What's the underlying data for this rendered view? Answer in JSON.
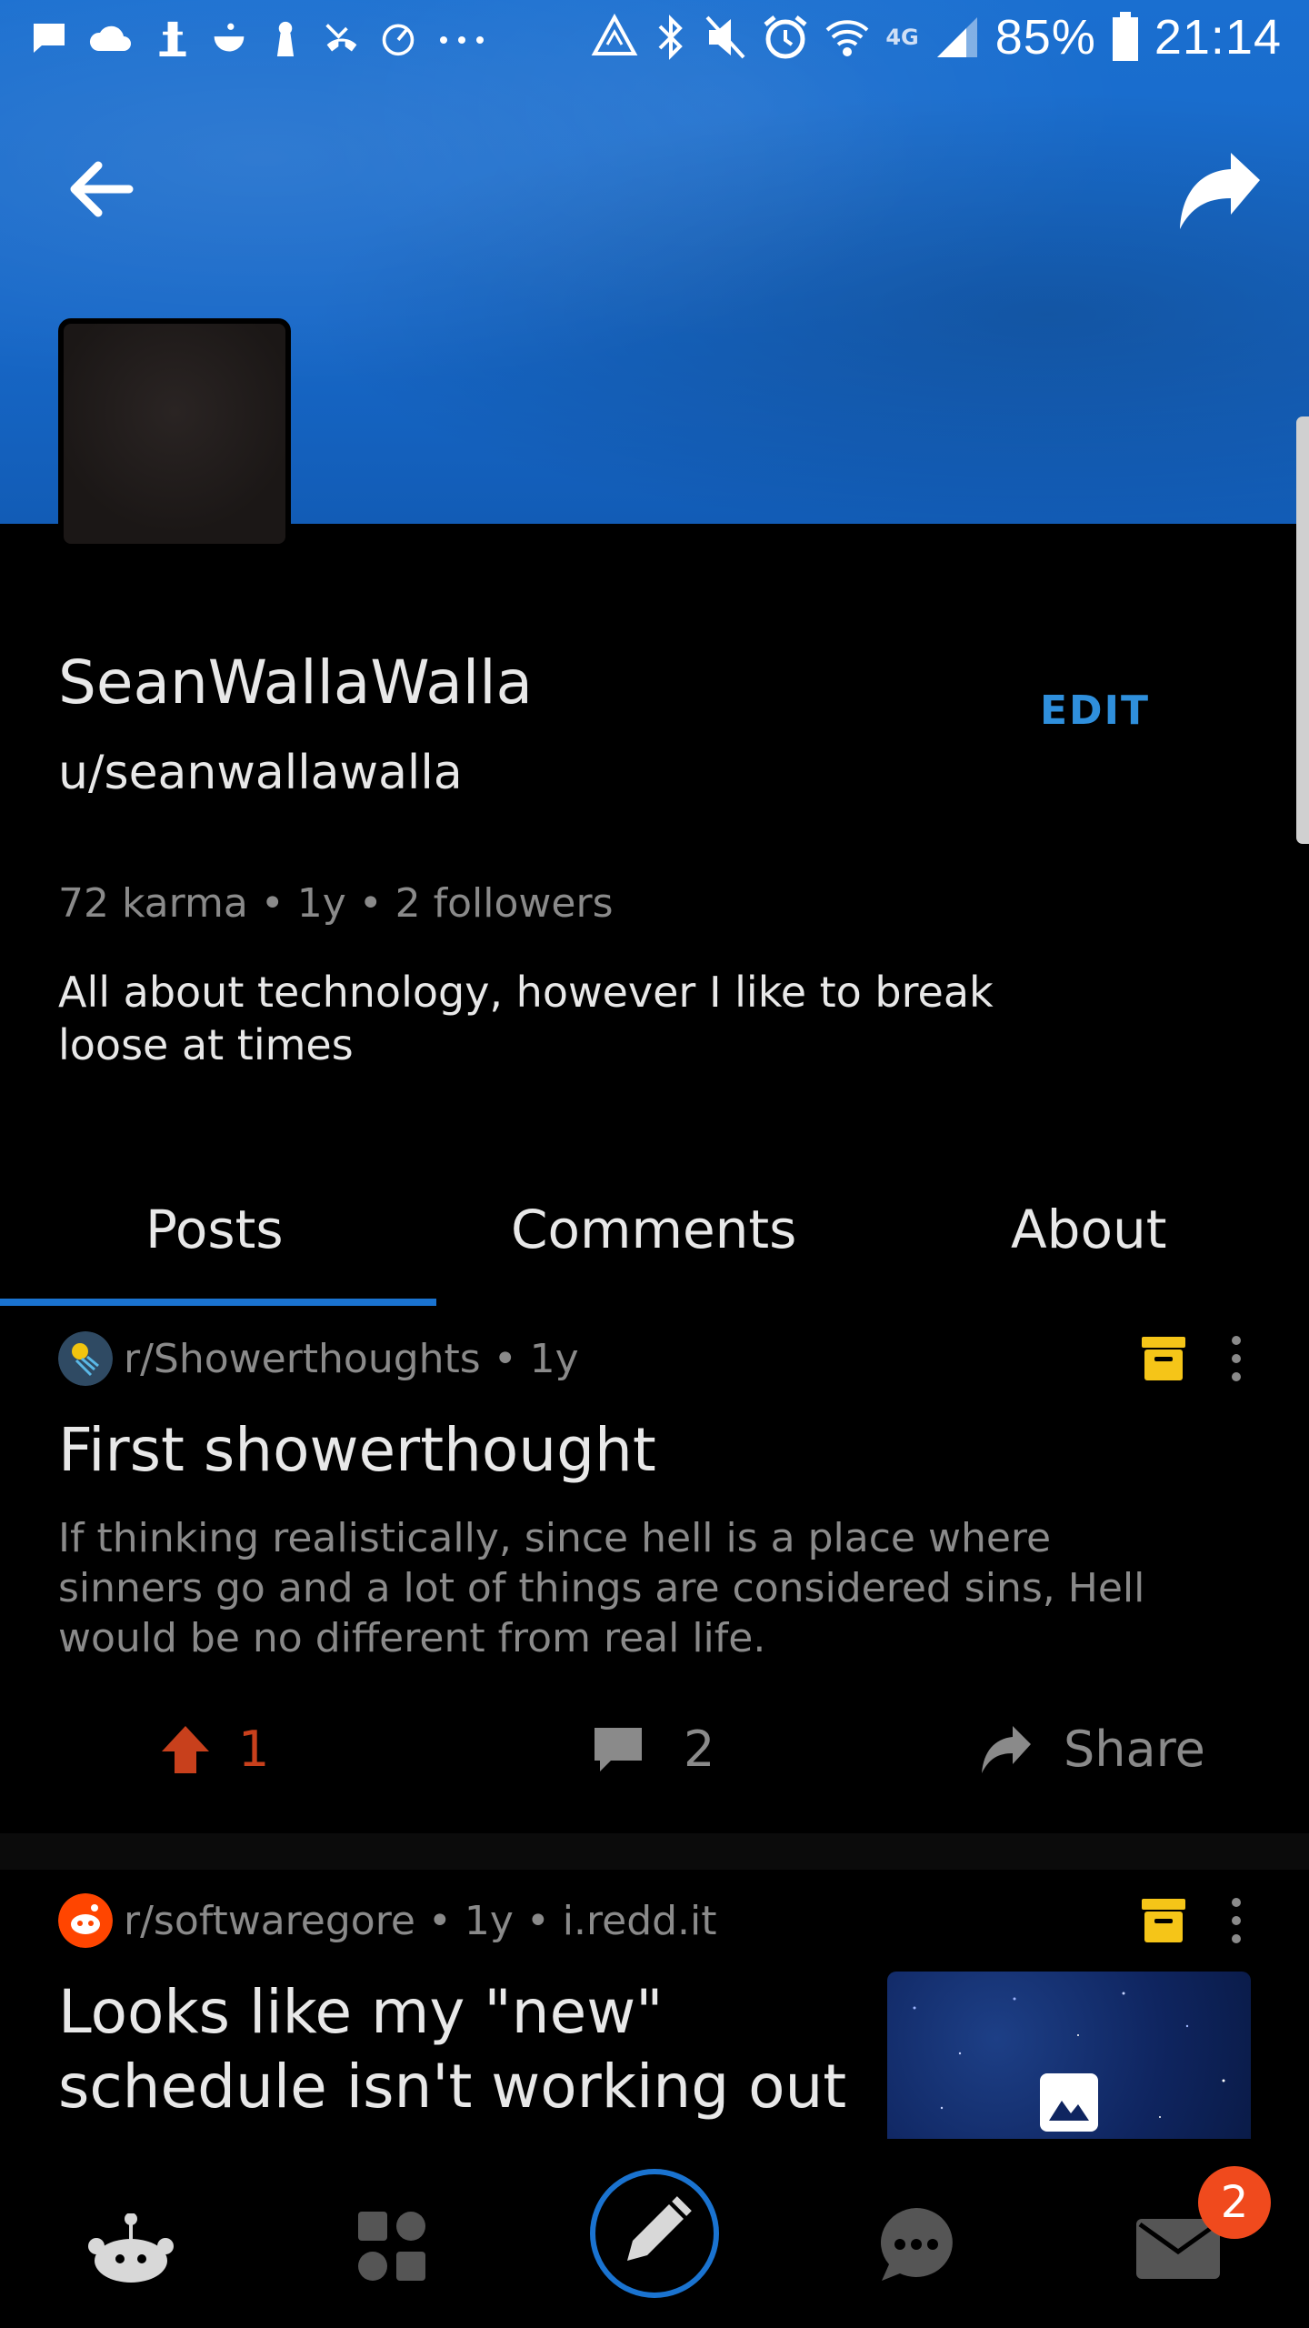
{
  "status_bar": {
    "battery": "85%",
    "time": "21:14",
    "network": "4G"
  },
  "profile": {
    "display_name": "SeanWallaWalla",
    "username": "u/seanwallawalla",
    "edit_label": "EDIT",
    "stats": "72 karma • 1y • 2 followers",
    "bio": "All about technology, however I like to break loose at times"
  },
  "tabs": [
    {
      "label": "Posts",
      "active": true
    },
    {
      "label": "Comments",
      "active": false
    },
    {
      "label": "About",
      "active": false
    }
  ],
  "posts": [
    {
      "meta": "r/Showerthoughts • 1y",
      "title": "First showerthought",
      "body": "If thinking realistically, since hell is a place where sinners go and a lot of things are considered sins, Hell would be no different from real life.",
      "upvotes": "1",
      "comments": "2",
      "share_label": "Share"
    },
    {
      "meta": "r/softwaregore • 1y • i.redd.it",
      "title": "Looks like my \"new\" schedule isn't working out"
    }
  ],
  "bottom_nav": {
    "inbox_badge": "2"
  },
  "colors": {
    "accent_blue": "#1a73d0",
    "edit_blue": "#2f8fdc",
    "upvote_orange": "#c8401c",
    "badge": "#f04a1d",
    "save_yellow": "#f5c518"
  }
}
